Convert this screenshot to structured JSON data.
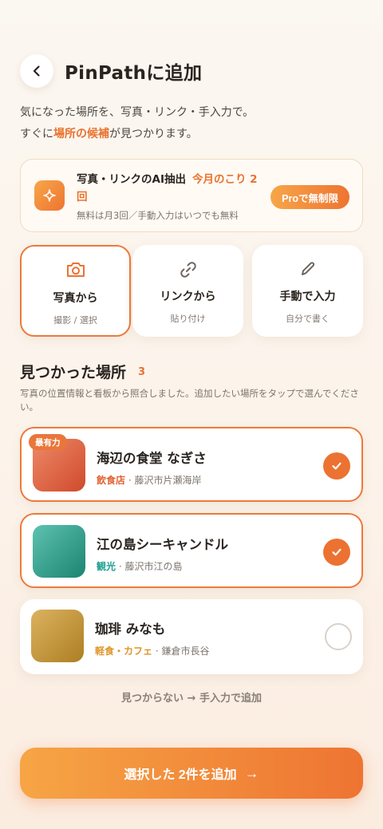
{
  "header": {
    "title": "PinPathに追加",
    "back_icon": "chevron-left-icon"
  },
  "intro": {
    "line1": "気になった場所を、写真・リンク・手入力で。",
    "line2_pre": "すぐに",
    "line2_highlight": "場所の候補",
    "line2_post": "が見つかります。"
  },
  "quota": {
    "icon": "sparkle-icon",
    "title": "写真・リンクのAI抽出",
    "remaining": "今月のこり 2回",
    "subtitle": "無料は月3回／手動入力はいつでも無料",
    "pro_button": "Proで無制限"
  },
  "methods": [
    {
      "icon": "camera-icon",
      "label": "写真から",
      "sub": "撮影 / 選択",
      "active": true
    },
    {
      "icon": "link-icon",
      "label": "リンクから",
      "sub": "貼り付け",
      "active": false
    },
    {
      "icon": "pencil-icon",
      "label": "手動で入力",
      "sub": "自分で書く",
      "active": false
    }
  ],
  "results": {
    "title": "見つかった場所",
    "count": "3",
    "description": "写真の位置情報と看板から照合しました。追加したい場所をタップで選んでください。"
  },
  "places": [
    {
      "name": "海辺の食堂 なぎさ",
      "category": "飲食店",
      "category_color": "#e0612f",
      "location": "藤沢市片瀬海岸",
      "selected": true,
      "badge": "最有力",
      "thumb_from": "#ee8a68",
      "thumb_to": "#cf4a2c"
    },
    {
      "name": "江の島シーキャンドル",
      "category": "観光",
      "category_color": "#1fa091",
      "location": "藤沢市江の島",
      "selected": true,
      "badge": "",
      "thumb_from": "#5ec2b0",
      "thumb_to": "#1b8471"
    },
    {
      "name": "珈琲 みなも",
      "category": "軽食・カフェ",
      "category_color": "#e0962b",
      "location": "鎌倉市長谷",
      "selected": false,
      "badge": "",
      "thumb_from": "#dcb260",
      "thumb_to": "#ad7f22"
    }
  ],
  "manual_link": "見つからない → 手入力で追加",
  "cta": {
    "label": "選択した 2件を追加",
    "arrow": "→"
  },
  "colors": {
    "accent": "#ec7232",
    "accent_light": "#f7a649",
    "text": "#2a2420",
    "muted": "#7d746c"
  }
}
